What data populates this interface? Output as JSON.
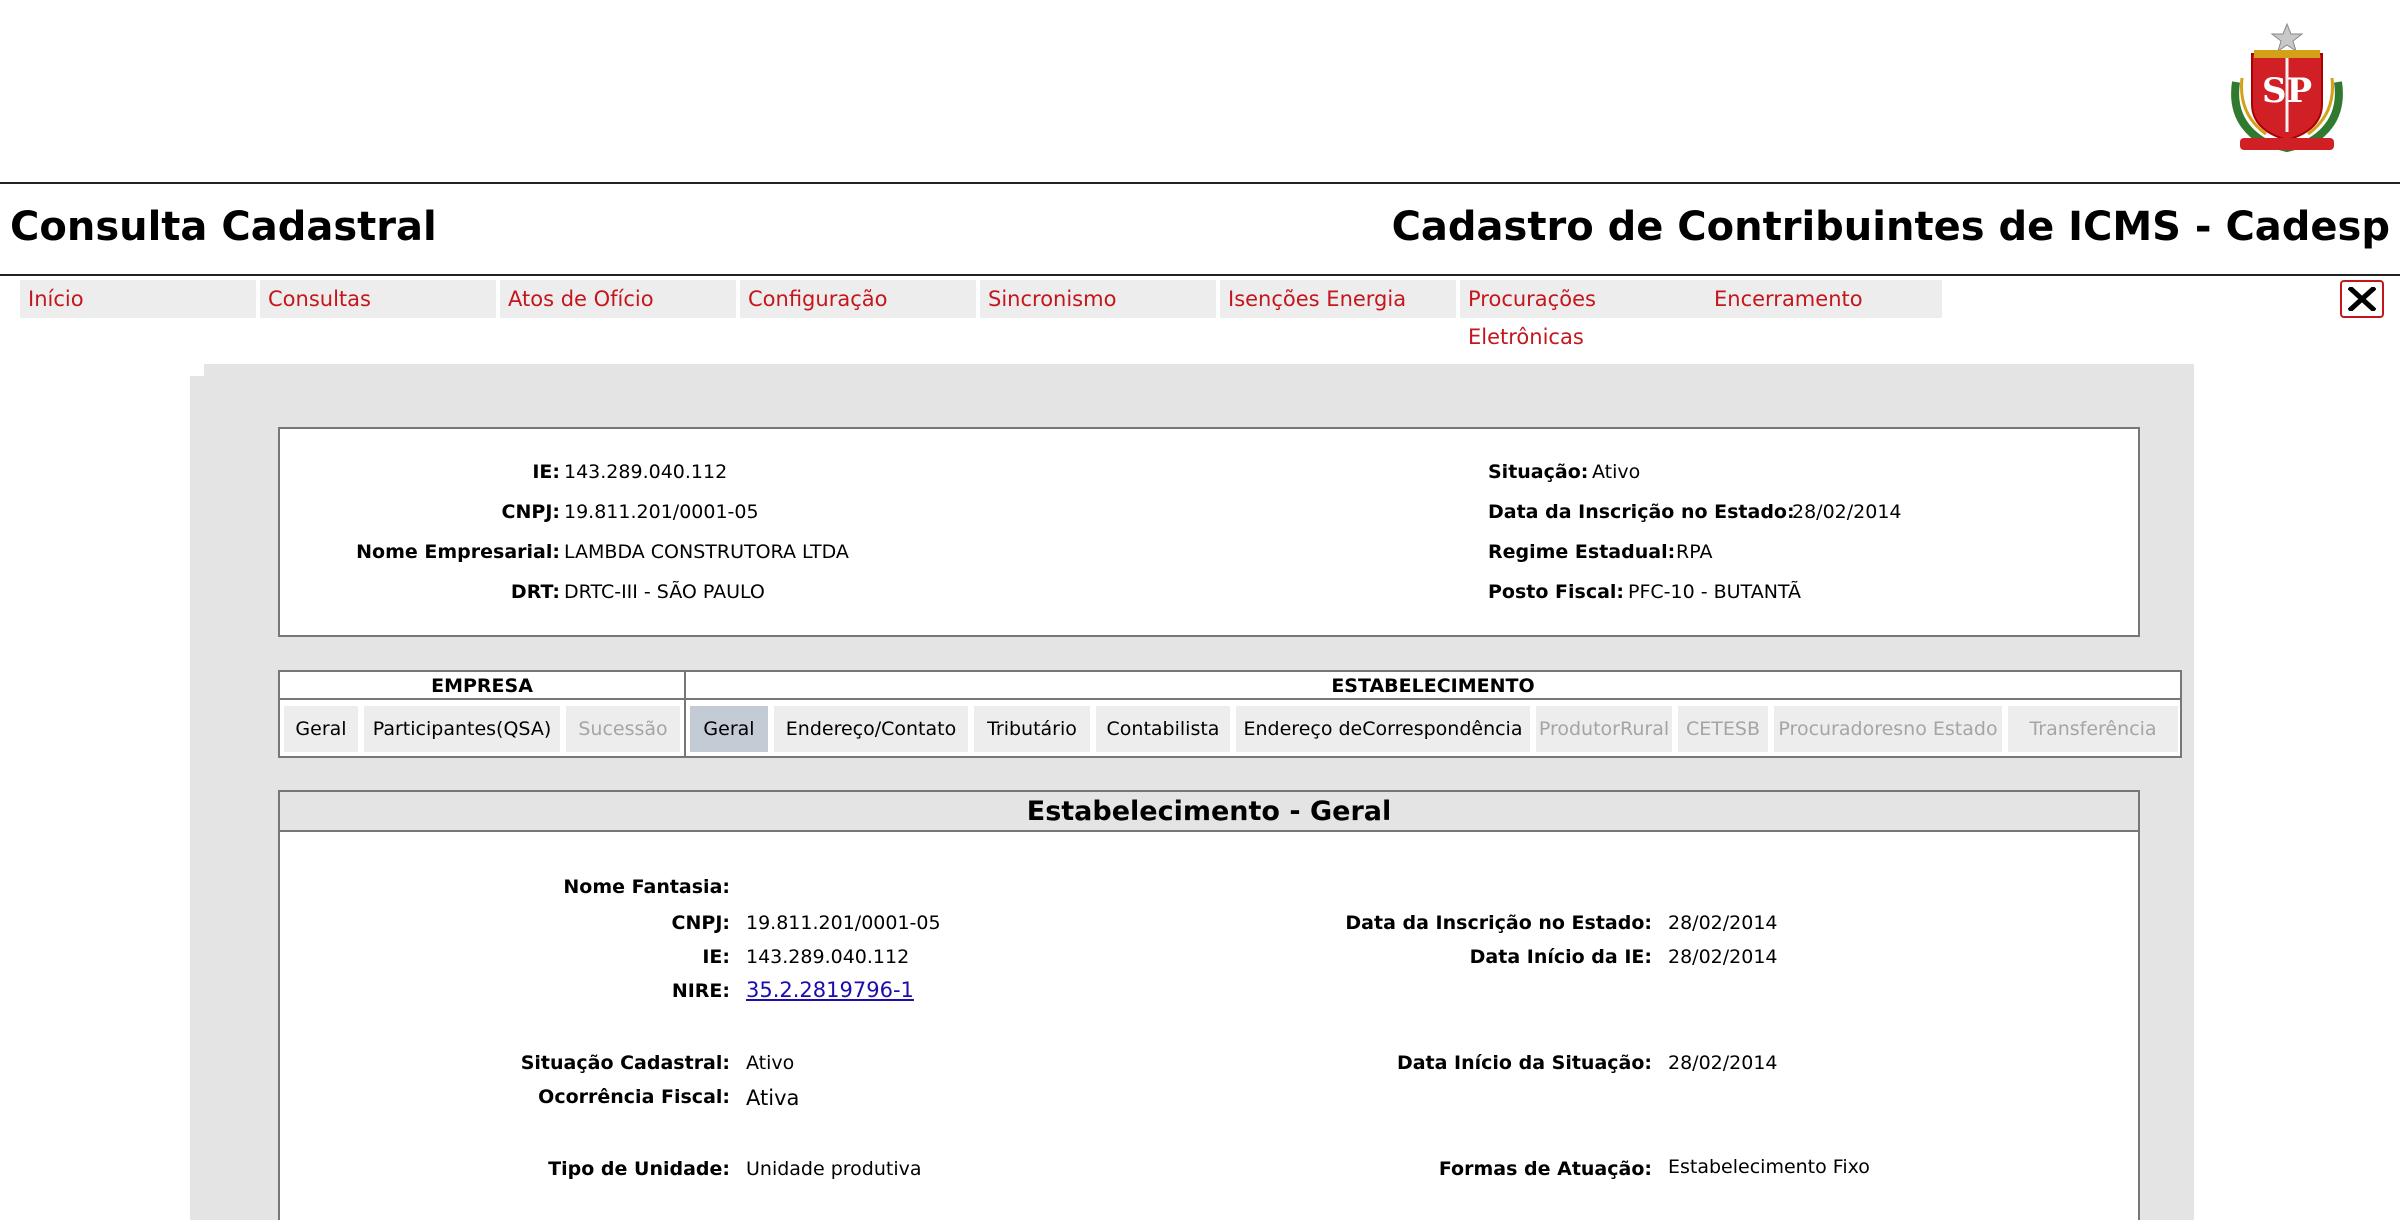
{
  "header": {
    "page_title": "Consulta Cadastral",
    "system_title": "Cadastro de Contribuintes de ICMS - Cadesp",
    "logo_text": "SP"
  },
  "menu": {
    "items": [
      {
        "label": "Início"
      },
      {
        "label": "Consultas"
      },
      {
        "label": "Atos de Ofício"
      },
      {
        "label": "Configuração"
      },
      {
        "label": "Sincronismo"
      },
      {
        "label": "Isenções Energia"
      },
      {
        "label": "Procurações Eletrônicas"
      },
      {
        "label": "Encerramento"
      }
    ],
    "close_icon": "close-icon"
  },
  "summary": {
    "ie_label": "IE:",
    "ie": "143.289.040.112",
    "cnpj_label": "CNPJ:",
    "cnpj": "19.811.201/0001-05",
    "nome_label": "Nome Empresarial:",
    "nome": "LAMBDA CONSTRUTORA LTDA",
    "drt_label": "DRT:",
    "drt": "DRTC-III - SÃO PAULO",
    "situacao_label": "Situação:",
    "situacao": "Ativo",
    "data_insc_label": "Data da Inscrição no Estado:",
    "data_insc": "28/02/2014",
    "regime_label": "Regime Estadual:",
    "regime": "RPA",
    "posto_label": "Posto Fiscal:",
    "posto": "PFC-10 - BUTANTÃ"
  },
  "tabs": {
    "empresa_title": "EMPRESA",
    "estabelecimento_title": "ESTABELECIMENTO",
    "empresa": [
      {
        "label": "Geral"
      },
      {
        "label": "Participantes(QSA)"
      },
      {
        "label": "Sucessão"
      }
    ],
    "estabelecimento": [
      {
        "label": "Geral"
      },
      {
        "label": "Endereço/Contato"
      },
      {
        "label": "Tributário"
      },
      {
        "label": "Contabilista"
      },
      {
        "label": "Endereço deCorrespondência"
      },
      {
        "label": "ProdutorRural"
      },
      {
        "label": "CETESB"
      },
      {
        "label": "Procuradoresno Estado"
      },
      {
        "label": "Transferência"
      }
    ]
  },
  "details": {
    "title": "Estabelecimento - Geral",
    "nome_fantasia_label": "Nome Fantasia:",
    "nome_fantasia": "",
    "cnpj_label": "CNPJ:",
    "cnpj": "19.811.201/0001-05",
    "ie_label": "IE:",
    "ie": "143.289.040.112",
    "nire_label": "NIRE:",
    "nire": "35.2.2819796-1",
    "data_insc_label": "Data da Inscrição no Estado:",
    "data_insc": "28/02/2014",
    "data_inicio_ie_label": "Data Início da IE:",
    "data_inicio_ie": "28/02/2014",
    "situacao_label": "Situação Cadastral:",
    "situacao": "Ativo",
    "ocorrencia_label": "Ocorrência Fiscal:",
    "ocorrencia": "Ativa",
    "data_inicio_sit_label": "Data Início da Situação:",
    "data_inicio_sit": "28/02/2014",
    "tipo_unidade_label": "Tipo de Unidade:",
    "tipo_unidade": "Unidade produtiva",
    "formas_label": "Formas de Atuação:",
    "formas": "Estabelecimento Fixo"
  }
}
